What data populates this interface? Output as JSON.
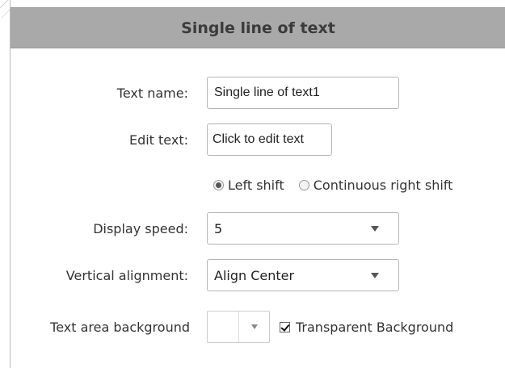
{
  "dialog": {
    "title": "Single line of text"
  },
  "form": {
    "text_name": {
      "label": "Text name:",
      "value": "Single line of text1"
    },
    "edit_text": {
      "label": "Edit text:",
      "value": "Click to edit text"
    },
    "scroll_mode": {
      "options": [
        {
          "label": "Left shift",
          "selected": true
        },
        {
          "label": "Continuous right shift",
          "selected": false
        }
      ]
    },
    "display_speed": {
      "label": "Display speed:",
      "value": "5"
    },
    "vertical_alignment": {
      "label": "Vertical alignment:",
      "value": "Align Center"
    },
    "text_area_background": {
      "label": "Text area background",
      "color": "#ffffff",
      "transparent": {
        "label": "Transparent Background",
        "checked": true
      }
    }
  }
}
